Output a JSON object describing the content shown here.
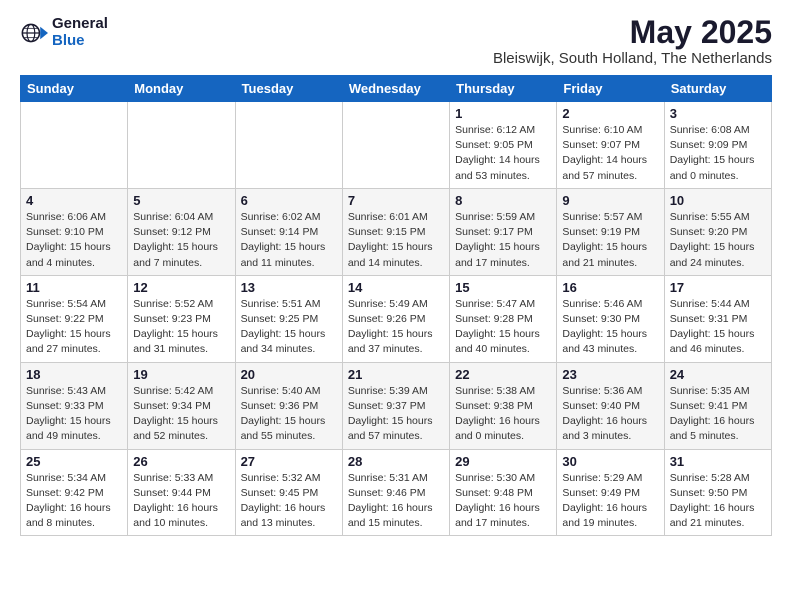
{
  "header": {
    "logo": {
      "general": "General",
      "blue": "Blue"
    },
    "title": "May 2025",
    "location": "Bleiswijk, South Holland, The Netherlands"
  },
  "weekdays": [
    "Sunday",
    "Monday",
    "Tuesday",
    "Wednesday",
    "Thursday",
    "Friday",
    "Saturday"
  ],
  "weeks": [
    [
      {
        "day": "",
        "info": ""
      },
      {
        "day": "",
        "info": ""
      },
      {
        "day": "",
        "info": ""
      },
      {
        "day": "",
        "info": ""
      },
      {
        "day": "1",
        "info": "Sunrise: 6:12 AM\nSunset: 9:05 PM\nDaylight: 14 hours\nand 53 minutes."
      },
      {
        "day": "2",
        "info": "Sunrise: 6:10 AM\nSunset: 9:07 PM\nDaylight: 14 hours\nand 57 minutes."
      },
      {
        "day": "3",
        "info": "Sunrise: 6:08 AM\nSunset: 9:09 PM\nDaylight: 15 hours\nand 0 minutes."
      }
    ],
    [
      {
        "day": "4",
        "info": "Sunrise: 6:06 AM\nSunset: 9:10 PM\nDaylight: 15 hours\nand 4 minutes."
      },
      {
        "day": "5",
        "info": "Sunrise: 6:04 AM\nSunset: 9:12 PM\nDaylight: 15 hours\nand 7 minutes."
      },
      {
        "day": "6",
        "info": "Sunrise: 6:02 AM\nSunset: 9:14 PM\nDaylight: 15 hours\nand 11 minutes."
      },
      {
        "day": "7",
        "info": "Sunrise: 6:01 AM\nSunset: 9:15 PM\nDaylight: 15 hours\nand 14 minutes."
      },
      {
        "day": "8",
        "info": "Sunrise: 5:59 AM\nSunset: 9:17 PM\nDaylight: 15 hours\nand 17 minutes."
      },
      {
        "day": "9",
        "info": "Sunrise: 5:57 AM\nSunset: 9:19 PM\nDaylight: 15 hours\nand 21 minutes."
      },
      {
        "day": "10",
        "info": "Sunrise: 5:55 AM\nSunset: 9:20 PM\nDaylight: 15 hours\nand 24 minutes."
      }
    ],
    [
      {
        "day": "11",
        "info": "Sunrise: 5:54 AM\nSunset: 9:22 PM\nDaylight: 15 hours\nand 27 minutes."
      },
      {
        "day": "12",
        "info": "Sunrise: 5:52 AM\nSunset: 9:23 PM\nDaylight: 15 hours\nand 31 minutes."
      },
      {
        "day": "13",
        "info": "Sunrise: 5:51 AM\nSunset: 9:25 PM\nDaylight: 15 hours\nand 34 minutes."
      },
      {
        "day": "14",
        "info": "Sunrise: 5:49 AM\nSunset: 9:26 PM\nDaylight: 15 hours\nand 37 minutes."
      },
      {
        "day": "15",
        "info": "Sunrise: 5:47 AM\nSunset: 9:28 PM\nDaylight: 15 hours\nand 40 minutes."
      },
      {
        "day": "16",
        "info": "Sunrise: 5:46 AM\nSunset: 9:30 PM\nDaylight: 15 hours\nand 43 minutes."
      },
      {
        "day": "17",
        "info": "Sunrise: 5:44 AM\nSunset: 9:31 PM\nDaylight: 15 hours\nand 46 minutes."
      }
    ],
    [
      {
        "day": "18",
        "info": "Sunrise: 5:43 AM\nSunset: 9:33 PM\nDaylight: 15 hours\nand 49 minutes."
      },
      {
        "day": "19",
        "info": "Sunrise: 5:42 AM\nSunset: 9:34 PM\nDaylight: 15 hours\nand 52 minutes."
      },
      {
        "day": "20",
        "info": "Sunrise: 5:40 AM\nSunset: 9:36 PM\nDaylight: 15 hours\nand 55 minutes."
      },
      {
        "day": "21",
        "info": "Sunrise: 5:39 AM\nSunset: 9:37 PM\nDaylight: 15 hours\nand 57 minutes."
      },
      {
        "day": "22",
        "info": "Sunrise: 5:38 AM\nSunset: 9:38 PM\nDaylight: 16 hours\nand 0 minutes."
      },
      {
        "day": "23",
        "info": "Sunrise: 5:36 AM\nSunset: 9:40 PM\nDaylight: 16 hours\nand 3 minutes."
      },
      {
        "day": "24",
        "info": "Sunrise: 5:35 AM\nSunset: 9:41 PM\nDaylight: 16 hours\nand 5 minutes."
      }
    ],
    [
      {
        "day": "25",
        "info": "Sunrise: 5:34 AM\nSunset: 9:42 PM\nDaylight: 16 hours\nand 8 minutes."
      },
      {
        "day": "26",
        "info": "Sunrise: 5:33 AM\nSunset: 9:44 PM\nDaylight: 16 hours\nand 10 minutes."
      },
      {
        "day": "27",
        "info": "Sunrise: 5:32 AM\nSunset: 9:45 PM\nDaylight: 16 hours\nand 13 minutes."
      },
      {
        "day": "28",
        "info": "Sunrise: 5:31 AM\nSunset: 9:46 PM\nDaylight: 16 hours\nand 15 minutes."
      },
      {
        "day": "29",
        "info": "Sunrise: 5:30 AM\nSunset: 9:48 PM\nDaylight: 16 hours\nand 17 minutes."
      },
      {
        "day": "30",
        "info": "Sunrise: 5:29 AM\nSunset: 9:49 PM\nDaylight: 16 hours\nand 19 minutes."
      },
      {
        "day": "31",
        "info": "Sunrise: 5:28 AM\nSunset: 9:50 PM\nDaylight: 16 hours\nand 21 minutes."
      }
    ]
  ]
}
